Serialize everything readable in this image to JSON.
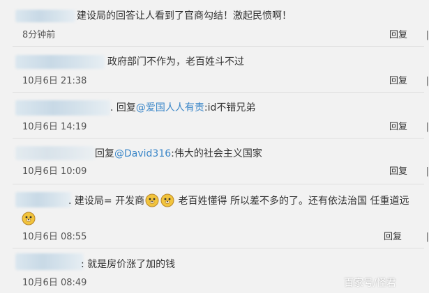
{
  "comments": [
    {
      "text": "建设局的回答让人看到了官商勾结！激起民愤啊！",
      "time": "8分钟前",
      "reply_label": "回复"
    },
    {
      "text": "政府部门不作为，老百姓斗不过",
      "time": "10月6日 21:38",
      "reply_label": "回复"
    },
    {
      "prefix": ". 回复",
      "mention": "@爱国人人有责",
      "suffix": ":id不错兄弟",
      "time": "10月6日 14:19",
      "reply_label": "回复"
    },
    {
      "prefix": "回复",
      "mention": "@David316",
      "suffix": ":伟大的社会主义国家",
      "time": "10月6日 10:09",
      "reply_label": "回复"
    },
    {
      "text_before": ". 建设局= 开发商",
      "text_after": "老百姓懂得 所以差不多的了。还有依法治国 任重道远",
      "time": "10月6日 08:55",
      "reply_label": "回复",
      "emoji": "doge-emoji"
    },
    {
      "text": ": 就是房价涨了加的钱",
      "time": "10月6日 08:49"
    }
  ],
  "watermark": "百家号/怪君"
}
